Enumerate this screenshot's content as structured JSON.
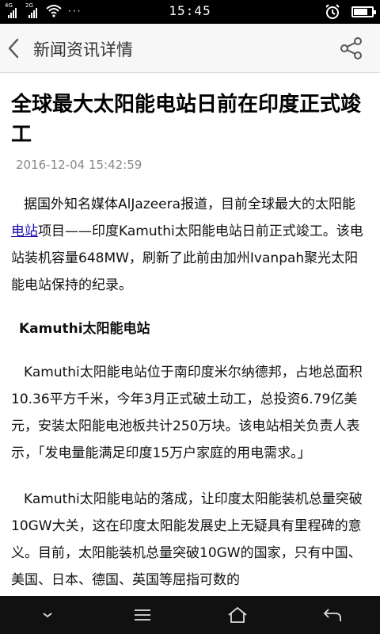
{
  "status_bar": {
    "net1": "4G",
    "net2": "2G",
    "dots": "···",
    "time": "15:45",
    "battery_level": 0.75
  },
  "header": {
    "title": "新闻资讯详情"
  },
  "article": {
    "title": "全球最大太阳能电站日前在印度正式竣工",
    "date": "2016-12-04 15:42:59",
    "p1_before_link": "据国外知名媒体AlJazeera报道，目前全球最大的太阳能",
    "p1_link": "电站",
    "p1_after_link": "项目——印度Kamuthi太阳能电站日前正式竣工。该电站装机容量648MW，刷新了此前由加州Ivanpah聚光太阳能电站保持的纪录。",
    "subheading": "Kamuthi太阳能电站",
    "p2": "Kamuthi太阳能电站位于南印度米尔纳德邦，占地总面积10.36平方千米，今年3月正式破土动工，总投资6.79亿美元，安装太阳能电池板共计250万块。该电站相关负责人表示，「发电量能满足印度15万户家庭的用电需求。」",
    "p3": "Kamuthi太阳能电站的落成，让印度太阳能装机总量突破10GW大关，这在印度太阳能发展史上无疑具有里程碑的意义。目前，太阳能装机总量突破10GW的国家，只有中国、美国、日本、德国、英国等屈指可数的"
  },
  "icons": {
    "back": "chevron-left-icon",
    "share": "share-icon",
    "nav_down": "chevron-down-icon",
    "nav_menu": "menu-icon",
    "nav_home": "home-icon",
    "nav_back": "return-icon"
  }
}
